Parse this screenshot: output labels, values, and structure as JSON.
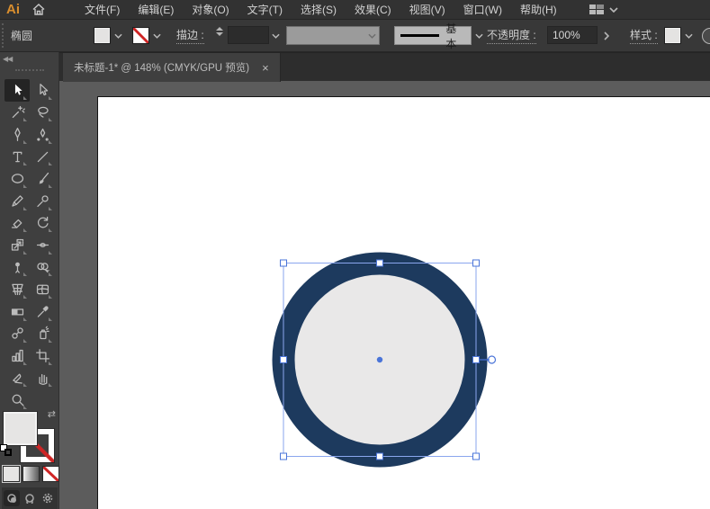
{
  "app": {
    "logo_text": "Ai"
  },
  "menubar": {
    "items": [
      "文件(F)",
      "编辑(E)",
      "对象(O)",
      "文字(T)",
      "选择(S)",
      "效果(C)",
      "视图(V)",
      "窗口(W)",
      "帮助(H)"
    ]
  },
  "controlbar": {
    "context_label": "椭圆",
    "stroke_label": "描边 :",
    "stroke_width_value": "",
    "stroke_profile_label": "基本",
    "opacity_label": "不透明度 :",
    "opacity_value": "100%",
    "style_label": "样式 :"
  },
  "tabbar": {
    "title": "未标题-1* @ 148% (CMYK/GPU 预览)",
    "close_glyph": "×"
  },
  "toolbar": {
    "collapse_glyph": "◀◀",
    "tools": [
      {
        "icon": "selection-tool-icon",
        "active": true
      },
      {
        "icon": "direct-selection-tool-icon"
      },
      {
        "icon": "magic-wand-tool-icon"
      },
      {
        "icon": "lasso-tool-icon"
      },
      {
        "icon": "pen-tool-icon"
      },
      {
        "icon": "curvature-tool-icon"
      },
      {
        "icon": "type-tool-icon"
      },
      {
        "icon": "line-segment-tool-icon"
      },
      {
        "icon": "ellipse-tool-icon"
      },
      {
        "icon": "paintbrush-tool-icon"
      },
      {
        "icon": "pencil-tool-icon"
      },
      {
        "icon": "shaper-tool-icon"
      },
      {
        "icon": "eraser-tool-icon"
      },
      {
        "icon": "rotate-tool-icon"
      },
      {
        "icon": "scale-tool-icon"
      },
      {
        "icon": "width-tool-icon"
      },
      {
        "icon": "puppet-warp-tool-icon"
      },
      {
        "icon": "shape-builder-tool-icon"
      },
      {
        "icon": "perspective-grid-tool-icon"
      },
      {
        "icon": "mesh-tool-icon"
      },
      {
        "icon": "gradient-tool-icon"
      },
      {
        "icon": "eyedropper-tool-icon"
      },
      {
        "icon": "blend-tool-icon"
      },
      {
        "icon": "symbol-sprayer-tool-icon"
      },
      {
        "icon": "column-graph-tool-icon"
      },
      {
        "icon": "artboard-tool-icon"
      },
      {
        "icon": "slice-tool-icon"
      },
      {
        "icon": "hand-tool-icon"
      },
      {
        "icon": "zoom-tool-icon"
      }
    ]
  },
  "canvas": {
    "shape": {
      "type": "ellipse",
      "fill_color": "#e9e8e8",
      "stroke_color": "#1d3a5e",
      "selected": true
    },
    "selection_color": "#4a74d8",
    "bbox_color": "#8aa6ee"
  },
  "colors": {
    "menubar_bg": "#323232",
    "controlbar_bg": "#383838",
    "tabbar_bg": "#2d2d2d",
    "dock_bg": "#3f3f3f",
    "pasteboard": "#5c5c5c",
    "artboard": "#ffffff",
    "accent_logo": "#d98e2e",
    "none_slash_red": "#cf2424"
  }
}
